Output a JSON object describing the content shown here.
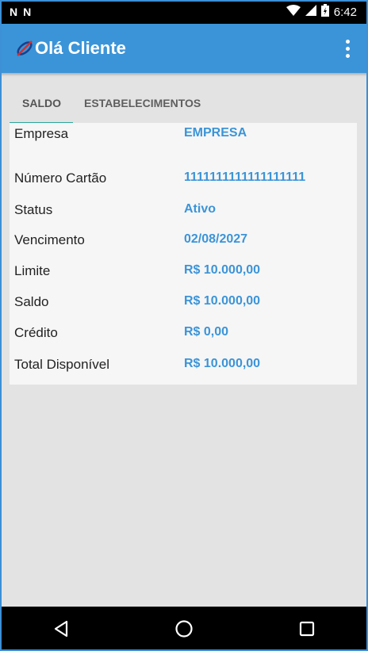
{
  "status_bar": {
    "notif_icons": [
      "N",
      "N"
    ],
    "time": "6:42"
  },
  "app_bar": {
    "title": "Olá Cliente",
    "accent": "#3b94d8"
  },
  "tabs": [
    {
      "label": "SALDO",
      "active": true
    },
    {
      "label": "ESTABELECIMENTOS",
      "active": false
    }
  ],
  "details": [
    {
      "label": "Empresa",
      "value": "EMPRESA"
    },
    {
      "label": "Número Cartão",
      "value": "1111111111111111111"
    },
    {
      "label": "Status",
      "value": "Ativo"
    },
    {
      "label": "Vencimento",
      "value": "02/08/2027"
    },
    {
      "label": "Limite",
      "value": "R$ 10.000,00"
    },
    {
      "label": "Saldo",
      "value": "R$ 10.000,00"
    },
    {
      "label": "Crédito",
      "value": "R$ 0,00"
    },
    {
      "label": "Total Disponível",
      "value": "R$ 10.000,00"
    }
  ],
  "icons": {
    "logo": "card-logo-icon",
    "menu": "more-vert-icon",
    "wifi": "wifi-icon",
    "signal": "signal-icon",
    "battery": "battery-icon",
    "back": "back-icon",
    "home": "home-icon",
    "recents": "recents-icon"
  }
}
